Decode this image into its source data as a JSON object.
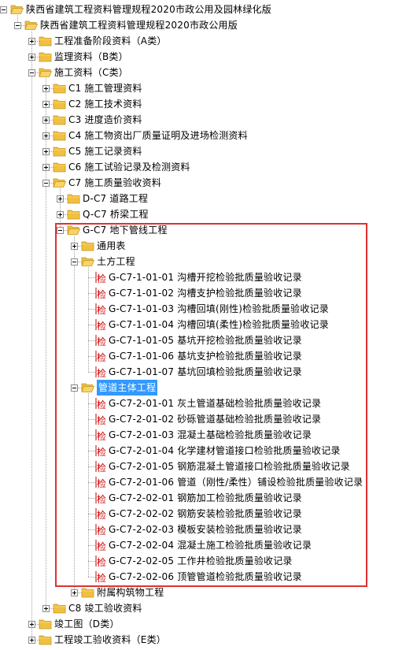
{
  "tree": [
    {
      "level": 0,
      "expanded": true,
      "type": "folder",
      "label": "陕西省建筑工程资料管理规程2020市政公用及园林绿化版",
      "name": "tree-node-root"
    },
    {
      "level": 1,
      "expanded": true,
      "type": "folder",
      "label": "陕西省建筑工程资料管理规程2020市政公用版",
      "name": "tree-node-municipal"
    },
    {
      "level": 2,
      "expanded": false,
      "type": "folder",
      "label": "工程准备阶段资料（A类）",
      "name": "tree-node-a"
    },
    {
      "level": 2,
      "expanded": false,
      "type": "folder",
      "label": "监理资料（B类）",
      "name": "tree-node-b"
    },
    {
      "level": 2,
      "expanded": true,
      "type": "folder",
      "label": "施工资料（C类）",
      "name": "tree-node-c"
    },
    {
      "level": 3,
      "expanded": false,
      "type": "folder",
      "label": "C1 施工管理资料",
      "name": "tree-node-c1"
    },
    {
      "level": 3,
      "expanded": false,
      "type": "folder",
      "label": "C2 施工技术资料",
      "name": "tree-node-c2"
    },
    {
      "level": 3,
      "expanded": false,
      "type": "folder",
      "label": "C3 进度造价资料",
      "name": "tree-node-c3"
    },
    {
      "level": 3,
      "expanded": false,
      "type": "folder",
      "label": "C4 施工物资出厂质量证明及进场检测资料",
      "name": "tree-node-c4"
    },
    {
      "level": 3,
      "expanded": false,
      "type": "folder",
      "label": "C5 施工记录资料",
      "name": "tree-node-c5"
    },
    {
      "level": 3,
      "expanded": false,
      "type": "folder",
      "label": "C6 施工试验记录及检测资料",
      "name": "tree-node-c6"
    },
    {
      "level": 3,
      "expanded": true,
      "type": "folder",
      "label": "C7 施工质量验收资料",
      "name": "tree-node-c7"
    },
    {
      "level": 4,
      "expanded": false,
      "type": "folder",
      "label": "D-C7 道路工程",
      "name": "tree-node-d-c7"
    },
    {
      "level": 4,
      "expanded": false,
      "type": "folder",
      "label": "Q-C7 桥梁工程",
      "name": "tree-node-q-c7"
    },
    {
      "level": 4,
      "expanded": true,
      "type": "folder",
      "label": "G-C7 地下管线工程",
      "name": "tree-node-g-c7"
    },
    {
      "level": 5,
      "expanded": false,
      "type": "folder",
      "label": "通用表",
      "name": "tree-node-general"
    },
    {
      "level": 5,
      "expanded": true,
      "type": "folder",
      "label": "土方工程",
      "name": "tree-node-earthwork"
    },
    {
      "level": 6,
      "type": "leaf",
      "label": "G-C7-1-01-01 沟槽开挖检验批质量验收记录",
      "name": "tree-leaf"
    },
    {
      "level": 6,
      "type": "leaf",
      "label": "G-C7-1-01-02 沟槽支护检验批质量验收记录",
      "name": "tree-leaf"
    },
    {
      "level": 6,
      "type": "leaf",
      "label": "G-C7-1-01-03 沟槽回填(刚性)检验批质量验收记录",
      "name": "tree-leaf"
    },
    {
      "level": 6,
      "type": "leaf",
      "label": "G-C7-1-01-04 沟槽回填(柔性)检验批质量验收记录",
      "name": "tree-leaf"
    },
    {
      "level": 6,
      "type": "leaf",
      "label": "G-C7-1-01-05 基坑开挖检验批质量验收记录",
      "name": "tree-leaf"
    },
    {
      "level": 6,
      "type": "leaf",
      "label": "G-C7-1-01-06 基坑支护检验批质量验收记录",
      "name": "tree-leaf"
    },
    {
      "level": 6,
      "type": "leaf",
      "label": "G-C7-1-01-07 基坑回填检验批质量验收记录",
      "name": "tree-leaf"
    },
    {
      "level": 5,
      "expanded": true,
      "type": "folder",
      "label": "管道主体工程",
      "name": "tree-node-pipeline-main",
      "selected": true
    },
    {
      "level": 6,
      "type": "leaf",
      "label": "G-C7-2-01-01 灰土管道基础检验批质量验收记录",
      "name": "tree-leaf"
    },
    {
      "level": 6,
      "type": "leaf",
      "label": "G-C7-2-01-02 砂砾管道基础检验批质量验收记录",
      "name": "tree-leaf"
    },
    {
      "level": 6,
      "type": "leaf",
      "label": "G-C7-2-01-03 混凝土基础检验批质量验收记录",
      "name": "tree-leaf"
    },
    {
      "level": 6,
      "type": "leaf",
      "label": "G-C7-2-01-04 化学建材管道接口检验批质量验收记录",
      "name": "tree-leaf"
    },
    {
      "level": 6,
      "type": "leaf",
      "label": "G-C7-2-01-05 钢筋混凝土管道接口检验批质量验收记录",
      "name": "tree-leaf"
    },
    {
      "level": 6,
      "type": "leaf",
      "label": "G-C7-2-01-06 管道（刚性/柔性）铺设检验批质量验收记录",
      "name": "tree-leaf"
    },
    {
      "level": 6,
      "type": "leaf",
      "label": "G-C7-2-02-01 钢筋加工检验批质量验收记录",
      "name": "tree-leaf"
    },
    {
      "level": 6,
      "type": "leaf",
      "label": "G-C7-2-02-02 钢筋安装检验批质量验收记录",
      "name": "tree-leaf"
    },
    {
      "level": 6,
      "type": "leaf",
      "label": "G-C7-2-02-03 模板安装检验批质量验收记录",
      "name": "tree-leaf"
    },
    {
      "level": 6,
      "type": "leaf",
      "label": "G-C7-2-02-04 混凝土施工检验批质量验收记录",
      "name": "tree-leaf"
    },
    {
      "level": 6,
      "type": "leaf",
      "label": "G-C7-2-02-05 工作井检验批质量验收记录",
      "name": "tree-leaf"
    },
    {
      "level": 6,
      "type": "leaf",
      "label": "G-C7-2-02-06 顶管管道检验批质量验收记录",
      "name": "tree-leaf"
    },
    {
      "level": 5,
      "expanded": false,
      "type": "folder",
      "label": "附属构筑物工程",
      "name": "tree-node-ancillary"
    },
    {
      "level": 3,
      "expanded": false,
      "type": "folder",
      "label": "C8 竣工验收资料",
      "name": "tree-node-c8"
    },
    {
      "level": 2,
      "expanded": false,
      "type": "folder",
      "label": "竣工图（D类）",
      "name": "tree-node-d"
    },
    {
      "level": 2,
      "expanded": false,
      "type": "folder",
      "label": "工程竣工验收资料（E类）",
      "name": "tree-node-e"
    }
  ],
  "leaf_icon_glyph": "检",
  "colors": {
    "folder": "#f0c040",
    "folder_edge": "#c8961e",
    "leaf_text": "#cc0000",
    "highlight": "#e03030",
    "selection": "#3399ff"
  }
}
